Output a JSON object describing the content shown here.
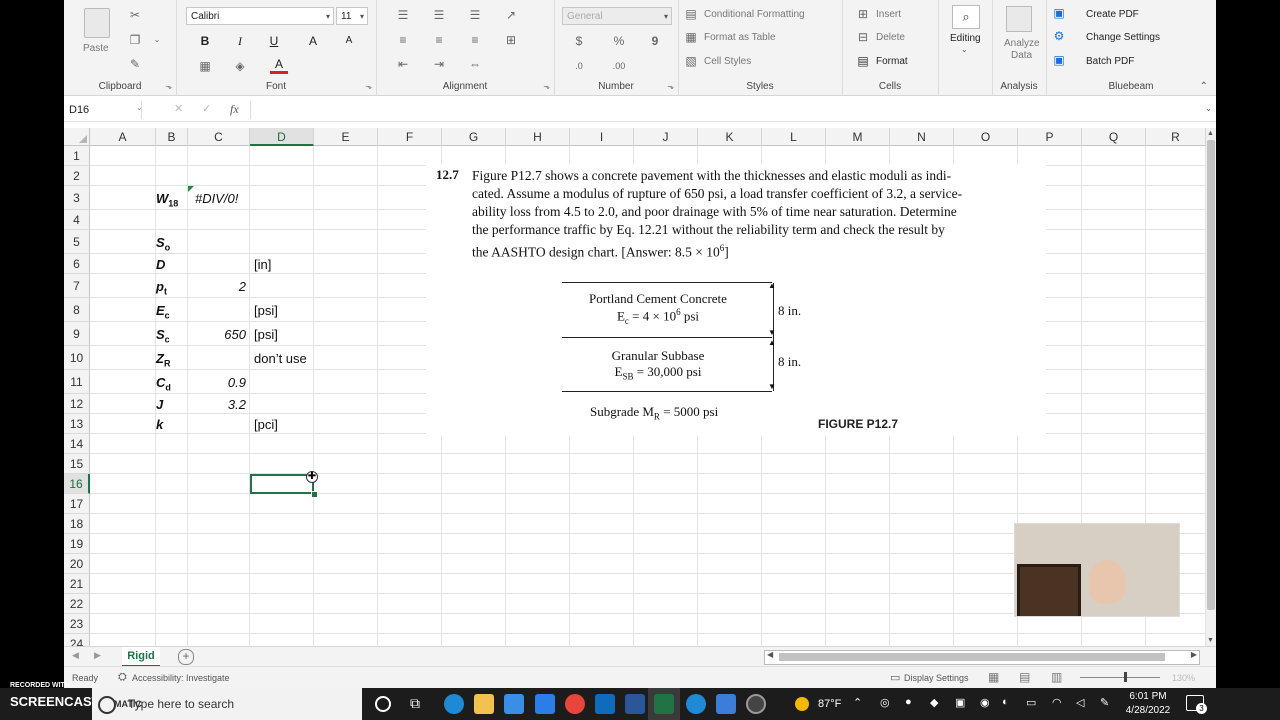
{
  "ribbon": {
    "clipboard": {
      "label": "Clipboard",
      "paste": "Paste"
    },
    "font": {
      "label": "Font",
      "family": "Calibri",
      "size": "11",
      "bold": "B",
      "italic": "I",
      "underline": "U",
      "grow": "A",
      "shrink": "A",
      "color_glyph": "A"
    },
    "alignment": {
      "label": "Alignment"
    },
    "number": {
      "label": "Number",
      "format": "General",
      "currency": "$",
      "percent": "%",
      "comma": "9"
    },
    "styles": {
      "label": "Styles",
      "conditional": "Conditional Formatting",
      "table": "Format as Table",
      "cell_styles": "Cell Styles"
    },
    "cells": {
      "label": "Cells",
      "insert": "Insert",
      "delete": "Delete",
      "format": "Format"
    },
    "editing": {
      "label": "Editing"
    },
    "analysis": {
      "label": "Analysis",
      "analyze_line1": "Analyze",
      "analyze_line2": "Data"
    },
    "bluebeam": {
      "label": "Bluebeam",
      "create_pdf": "Create PDF",
      "change_settings": "Change Settings",
      "batch_pdf": "Batch PDF"
    }
  },
  "formula_bar": {
    "name_box": "D16",
    "fx": "fx",
    "cancel": "✕",
    "enter": "✓",
    "content": ""
  },
  "columns": [
    "A",
    "B",
    "C",
    "D",
    "E",
    "F",
    "G",
    "H",
    "I",
    "J",
    "K",
    "L",
    "M",
    "N",
    "O",
    "P",
    "Q",
    "R"
  ],
  "rows": [
    "1",
    "2",
    "3",
    "4",
    "5",
    "6",
    "7",
    "8",
    "9",
    "10",
    "11",
    "12",
    "13",
    "14",
    "15",
    "16",
    "17",
    "18",
    "19",
    "20",
    "21",
    "22",
    "23",
    "24"
  ],
  "cells": {
    "B3": {
      "main": "W",
      "sub": "18"
    },
    "C3": "#DIV/0!",
    "B5": {
      "main": "S",
      "sub": "o"
    },
    "B6": {
      "main": "D",
      "sub": ""
    },
    "D6": "[in]",
    "B7": {
      "main": "p",
      "sub": "t"
    },
    "C7": "2",
    "B8": {
      "main": "E",
      "sub": "c"
    },
    "D8": "[psi]",
    "B9": {
      "main": "S",
      "sub": "c"
    },
    "C9": "650",
    "D9": "[psi]",
    "B10": {
      "main": "Z",
      "sub": "R"
    },
    "D10": "don’t use",
    "B11": {
      "main": "C",
      "sub": "d"
    },
    "C11": "0.9",
    "B12": {
      "main": "J",
      "sub": ""
    },
    "C12": "3.2",
    "B13": {
      "main": "k",
      "sub": ""
    },
    "D13": "[pci]"
  },
  "problem": {
    "number": "12.7",
    "lines": [
      "Figure P12.7 shows a concrete pavement with the thicknesses and elastic moduli as indi-",
      "cated. Assume a modulus of rupture of 650 psi, a load transfer coefficient of 3.2, a service-",
      "ability loss from 4.5 to 2.0, and poor drainage with 5% of time near saturation. Determine",
      "the performance traffic by Eq. 12.21 without the reliability term and check the result by"
    ],
    "last_line_text": "the AASHTO design chart. [Answer: 8.5 × 10",
    "last_line_exp": "6",
    "last_line_end": "]",
    "layer1_name": "Portland Cement Concrete",
    "layer1_mod_prefix": "E",
    "layer1_mod_sub": "c",
    "layer1_mod_mid": " = 4 × 10",
    "layer1_mod_exp": "6",
    "layer1_mod_end": " psi",
    "layer1_thick": "8 in.",
    "layer2_name": "Granular Subbase",
    "layer2_mod_prefix": "E",
    "layer2_mod_sub": "SB",
    "layer2_mod_end": " = 30,000 psi",
    "layer2_thick": "8 in.",
    "subgrade_prefix": "Subgrade M",
    "subgrade_sub": "R",
    "subgrade_end": " = 5000 psi",
    "figure_label": "FIGURE P12.7"
  },
  "sheet_tabs": {
    "active": "Rigid",
    "add": "+"
  },
  "status": {
    "ready": "Ready",
    "accessibility": "Accessibility: Investigate",
    "display": "Display Settings",
    "zoom": "130%"
  },
  "taskbar": {
    "search_placeholder": "Type here to search",
    "weather": "87°F",
    "time": "6:01 PM",
    "date": "4/28/2022",
    "notifications": "3"
  },
  "watermark": {
    "recorded": "RECORDED WITH",
    "brand": "SCREENCAST",
    "suffix": "MATIC"
  }
}
